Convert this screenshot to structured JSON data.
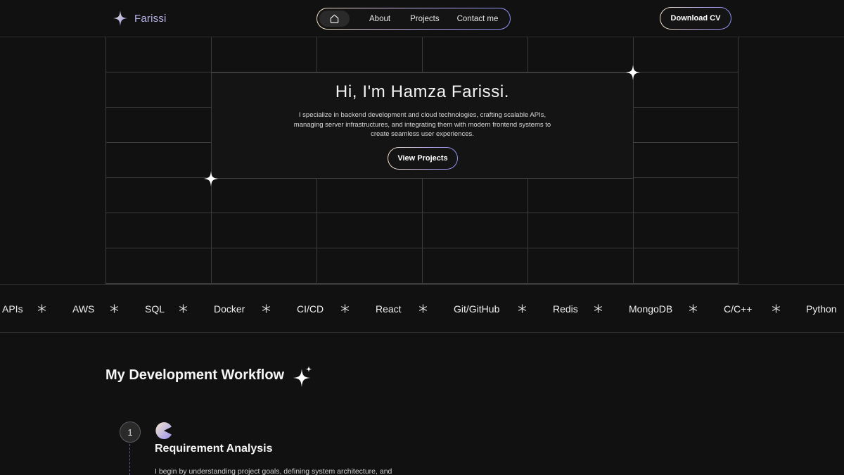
{
  "header": {
    "brand": "Farissi",
    "nav": {
      "home_icon": "home-icon",
      "about": "About",
      "projects": "Projects",
      "contact": "Contact me"
    },
    "download_cv": "Download CV"
  },
  "hero": {
    "title": "Hi, I'm Hamza Farissi.",
    "description": "I specialize in backend development and cloud technologies, crafting scalable APIs, managing server infrastructures, and integrating them with modern frontend systems to create seamless user experiences.",
    "cta": "View Projects"
  },
  "skills": [
    "APIs",
    "AWS",
    "SQL",
    "Docker",
    "CI/CD",
    "React",
    "Git/GitHub",
    "Redis",
    "MongoDB",
    "C/C++",
    "Python"
  ],
  "workflow": {
    "title": "My Development Workflow",
    "steps": [
      {
        "number": "1",
        "icon": "pacman-icon",
        "title": "Requirement Analysis",
        "description": "I begin by understanding project goals, defining system architecture, and"
      }
    ]
  },
  "colors": {
    "background": "#111111",
    "brand_text": "#b9b4e8",
    "accent_gold": "#efe2c2",
    "accent_violet": "#8d8ef2"
  }
}
